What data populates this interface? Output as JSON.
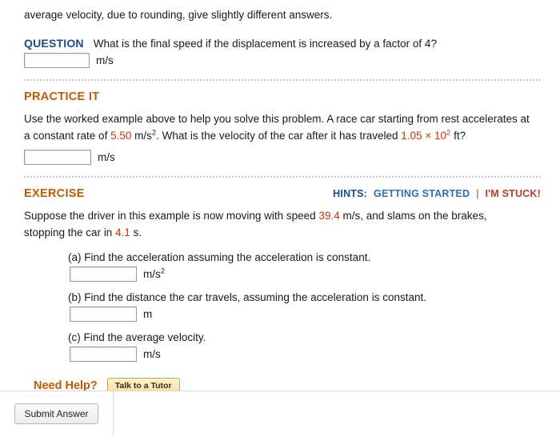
{
  "intro": {
    "text": "average velocity, due to rounding, give slightly different answers."
  },
  "question": {
    "label": "QUESTION",
    "text": "What is the final speed if the displacement is increased by a factor of 4?",
    "answer_value": "",
    "unit": "m/s"
  },
  "practice": {
    "heading": "PRACTICE IT",
    "line1_a": "Use the worked example above to help you solve this problem. A race car starting from rest accelerates at",
    "line2_a": "a constant rate of ",
    "accel_value": "5.50",
    "line2_b": " m/s",
    "accel_exp": "2",
    "line2_c": ". What is the velocity of the car after it has traveled ",
    "dist_mantissa": "1.05",
    "dist_times": "×",
    "dist_base": "10",
    "dist_exp": "2",
    "line2_d": " ft?",
    "answer_value": "",
    "unit": "m/s"
  },
  "exercise": {
    "heading": "EXERCISE",
    "hints_label": "HINTS:",
    "hints_link": "GETTING STARTED",
    "hints_divider": "|",
    "stuck_link": "I'M STUCK!",
    "prompt_a": "Suppose the driver in this example is now moving with speed ",
    "speed_value": "39.4",
    "prompt_b": " m/s, and slams on the brakes,",
    "prompt_c": "stopping the car in ",
    "time_value": "4.1",
    "prompt_d": " s.",
    "parts": [
      {
        "text": "(a) Find the acceleration assuming the acceleration is constant.",
        "answer_value": "",
        "unit": "m/s",
        "unit_exp": "2"
      },
      {
        "text": "(b) Find the distance the car travels, assuming the acceleration is constant.",
        "answer_value": "",
        "unit": "m",
        "unit_exp": ""
      },
      {
        "text": "(c) Find the average velocity.",
        "answer_value": "",
        "unit": "m/s",
        "unit_exp": ""
      }
    ]
  },
  "need_help": {
    "label": "Need Help?",
    "button_label": "Talk to a Tutor"
  },
  "footer": {
    "submit_label": "Submit Answer"
  },
  "colors": {
    "question_blue": "#1a4b8c",
    "section_orange": "#c25a00",
    "number_red": "#cc3300",
    "link_blue": "#2a6fba",
    "stuck_red": "#c0392b"
  }
}
